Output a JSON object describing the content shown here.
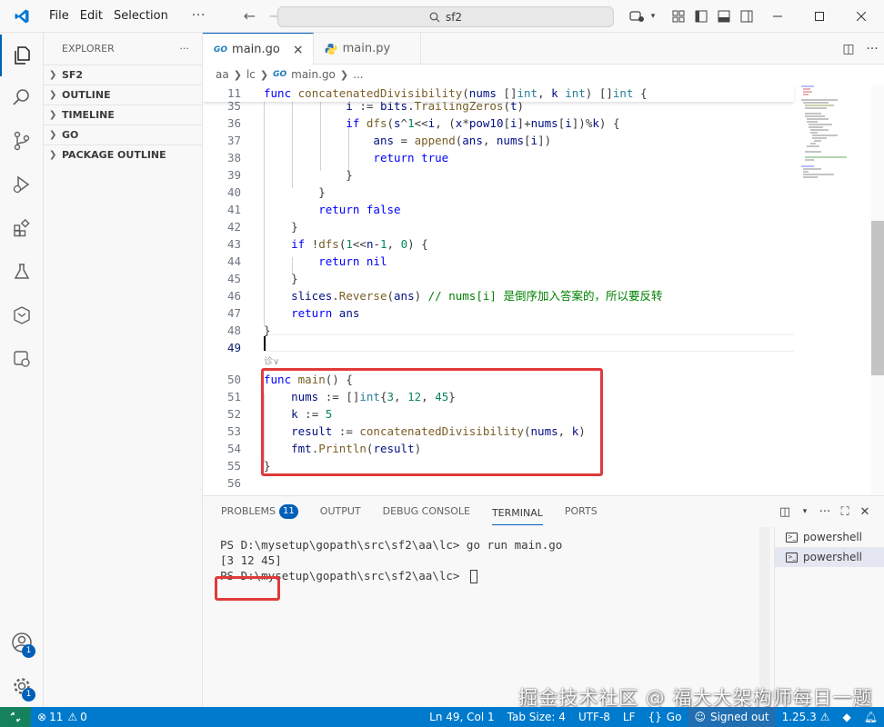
{
  "menu": {
    "file": "File",
    "edit": "Edit",
    "selection": "Selection",
    "more": "···"
  },
  "search": {
    "text": "sf2"
  },
  "sidebar": {
    "title": "EXPLORER",
    "more": "···",
    "sections": [
      "SF2",
      "OUTLINE",
      "TIMELINE",
      "GO",
      "PACKAGE OUTLINE"
    ]
  },
  "tabs": [
    {
      "label": "main.go",
      "icon": "GO",
      "close": "×"
    },
    {
      "label": "main.py"
    }
  ],
  "breadcrumb": {
    "p1": "aa",
    "p2": "lc",
    "icon": "GO",
    "p3": "main.go",
    "p4": "..."
  },
  "editor": {
    "codelens": "诊∨",
    "lines": [
      {
        "n": "11",
        "html": "<span class='kw'>func</span> <span class='fn'>concatenatedDivisibility</span>(<span class='vr'>nums</span> []<span class='ty'>int</span>, <span class='vr'>k</span> <span class='ty'>int</span>) []<span class='ty'>int</span> {"
      },
      {
        "n": "35",
        "html": "            <span class='vr'>i</span> := <span class='vr'>bits</span>.<span class='fn'>TrailingZeros</span>(<span class='vr'>t</span>)"
      },
      {
        "n": "36",
        "html": "            <span class='kw'>if</span> <span class='fn'>dfs</span>(<span class='vr'>s</span>^<span class='num'>1</span>&lt;&lt;<span class='vr'>i</span>, (<span class='vr'>x</span>*<span class='vr'>pow10</span>[<span class='vr'>i</span>]+<span class='vr'>nums</span>[<span class='vr'>i</span>])%<span class='vr'>k</span>) {"
      },
      {
        "n": "37",
        "html": "                <span class='vr'>ans</span> = <span class='fn'>append</span>(<span class='vr'>ans</span>, <span class='vr'>nums</span>[<span class='vr'>i</span>])"
      },
      {
        "n": "38",
        "html": "                <span class='kw'>return</span> <span class='kw'>true</span>"
      },
      {
        "n": "39",
        "html": "            }"
      },
      {
        "n": "40",
        "html": "        }"
      },
      {
        "n": "41",
        "html": "        <span class='kw'>return</span> <span class='kw'>false</span>"
      },
      {
        "n": "42",
        "html": "    }"
      },
      {
        "n": "43",
        "html": "    <span class='kw'>if</span> !<span class='fn'>dfs</span>(<span class='num'>1</span>&lt;&lt;<span class='vr'>n</span>-<span class='num'>1</span>, <span class='num'>0</span>) {"
      },
      {
        "n": "44",
        "html": "        <span class='kw'>return</span> <span class='kw'>nil</span>"
      },
      {
        "n": "45",
        "html": "    }"
      },
      {
        "n": "46",
        "html": "    <span class='vr'>slices</span>.<span class='fn'>Reverse</span>(<span class='vr'>ans</span>) <span class='cm'>// nums[i] 是倒序加入答案的，所以要反转</span>"
      },
      {
        "n": "47",
        "html": "    <span class='kw'>return</span> <span class='vr'>ans</span>"
      },
      {
        "n": "48",
        "html": "}"
      },
      {
        "n": "49",
        "html": ""
      },
      {
        "n": "50",
        "html": "<span class='kw'>func</span> <span class='fn'>main</span>() {"
      },
      {
        "n": "51",
        "html": "    <span class='vr'>nums</span> := []<span class='ty'>int</span>{<span class='num'>3</span>, <span class='num'>12</span>, <span class='num'>45</span>}"
      },
      {
        "n": "52",
        "html": "    <span class='vr'>k</span> := <span class='num'>5</span>"
      },
      {
        "n": "53",
        "html": "    <span class='vr'>result</span> := <span class='fn'>concatenatedDivisibility</span>(<span class='vr'>nums</span>, <span class='vr'>k</span>)"
      },
      {
        "n": "54",
        "html": "    <span class='vr'>fmt</span>.<span class='fn'>Println</span>(<span class='vr'>result</span>)"
      },
      {
        "n": "55",
        "html": "}"
      },
      {
        "n": "56",
        "html": ""
      }
    ]
  },
  "panel": {
    "tabs": [
      "PROBLEMS",
      "OUTPUT",
      "DEBUG CONSOLE",
      "TERMINAL",
      "PORTS"
    ],
    "problems_count": "11",
    "terminal_lines": [
      "PS D:\\mysetup\\gopath\\src\\sf2\\aa\\lc> go run main.go",
      "[3 12 45]",
      "PS D:\\mysetup\\gopath\\src\\sf2\\aa\\lc> "
    ],
    "terminals": [
      "powershell",
      "powershell"
    ]
  },
  "statusbar": {
    "errors": "11",
    "warnings": "0",
    "position": "Ln 49, Col 1",
    "tab_size": "Tab Size: 4",
    "encoding": "UTF-8",
    "eol": "LF",
    "language": "Go",
    "account": "Signed out",
    "version": "1.25.3"
  },
  "badges": {
    "accounts": "1",
    "manage": "1"
  },
  "watermark": "掘金技术社区 @ 福大大架构师每日一题",
  "colors": {
    "accent": "#005fb8",
    "statusbar": "#007acc",
    "highlight": "#e03a3a"
  }
}
